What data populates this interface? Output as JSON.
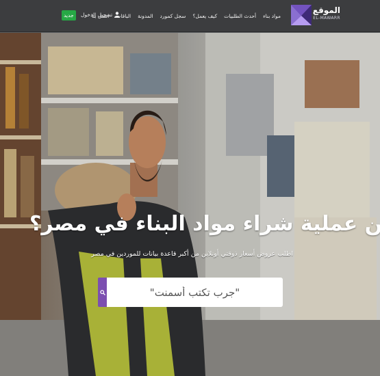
{
  "brand": {
    "logo_main": "الموقع",
    "logo_sub": "EL-MAWARR",
    "accent": "#7c4fb0"
  },
  "nav": {
    "items": [
      "مواد بناء",
      "أحدث الطلبيات",
      "كيف يعمل؟",
      "سجل كمورد",
      "المدونة",
      "الباقات",
      "اتصل بنا"
    ],
    "login_label": "تسجيل الدخول",
    "new_label": "جديد",
    "new_color": "#26a845"
  },
  "hero": {
    "headline": "تعبت من عملية شراء مواد البناء في مصر؟",
    "subline": "اطلب عروض أسعار ذوقتي أونلاين من أكبر قاعدة بيانات للموردين في مصر",
    "search_placeholder": "\"جرب تكتب أسمنت\"",
    "search_icon": "search-icon"
  }
}
